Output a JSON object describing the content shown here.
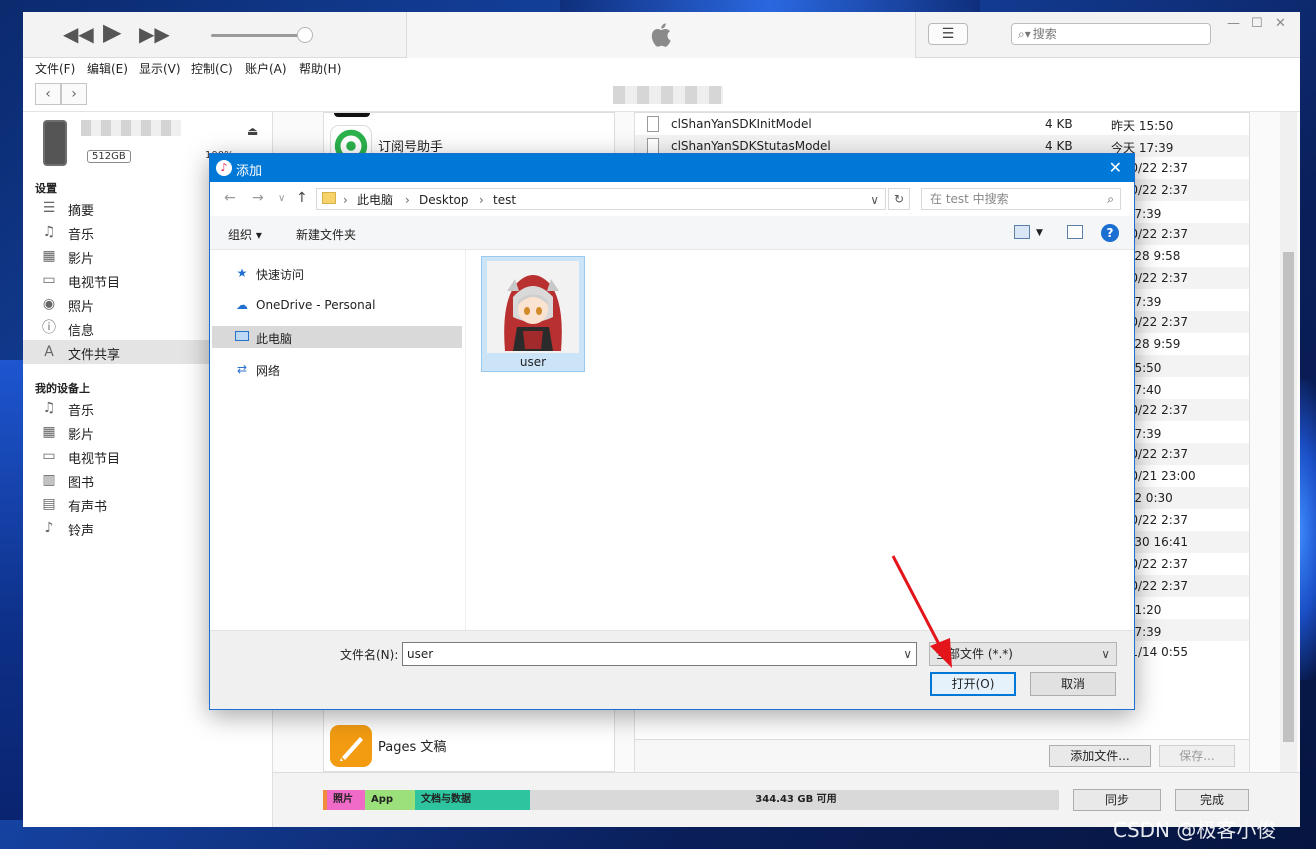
{
  "window": {
    "menu": [
      "文件(F)",
      "编辑(E)",
      "显示(V)",
      "控制(C)",
      "账户(A)",
      "帮助(H)"
    ],
    "search_placeholder": "搜索"
  },
  "sidebar": {
    "capacity": "512GB",
    "battery": "100%",
    "section_settings": "设置",
    "settings_items": [
      {
        "icon": "list-icon",
        "label": "摘要"
      },
      {
        "icon": "music-note-icon",
        "label": "音乐"
      },
      {
        "icon": "film-icon",
        "label": "影片"
      },
      {
        "icon": "tv-icon",
        "label": "电视节目"
      },
      {
        "icon": "camera-icon",
        "label": "照片"
      },
      {
        "icon": "info-icon",
        "label": "信息"
      },
      {
        "icon": "app-store-icon",
        "label": "文件共享"
      }
    ],
    "section_device": "我的设备上",
    "device_items": [
      {
        "icon": "music-note-icon",
        "label": "音乐"
      },
      {
        "icon": "film-icon",
        "label": "影片"
      },
      {
        "icon": "tv-icon",
        "label": "电视节目"
      },
      {
        "icon": "book-icon",
        "label": "图书"
      },
      {
        "icon": "audiobook-icon",
        "label": "有声书"
      },
      {
        "icon": "bell-icon",
        "label": "铃声"
      }
    ]
  },
  "apps": [
    {
      "name": "订阅号助手",
      "color": "#2bb24c"
    },
    {
      "name": "Pages 文稿",
      "color": "#f39c12"
    }
  ],
  "files": [
    {
      "name": "clShanYanSDKInitModel",
      "size": "4 KB",
      "date": "昨天 15:50"
    },
    {
      "name": "clShanYanSDKStutasModel",
      "size": "4 KB",
      "date": "今天 17:39"
    },
    {
      "name": "",
      "size": "",
      "date": "3/10/22 2:37"
    },
    {
      "name": "",
      "size": "",
      "date": "3/10/22 2:37"
    },
    {
      "name": "",
      "size": "",
      "date": "天 17:39"
    },
    {
      "name": "",
      "size": "",
      "date": "3/10/22 2:37"
    },
    {
      "name": "",
      "size": "",
      "date": "3/9/28 9:58"
    },
    {
      "name": "",
      "size": "",
      "date": "3/10/22 2:37"
    },
    {
      "name": "",
      "size": "",
      "date": "天 17:39"
    },
    {
      "name": "",
      "size": "",
      "date": "3/10/22 2:37"
    },
    {
      "name": "",
      "size": "",
      "date": "3/9/28 9:59"
    },
    {
      "name": "",
      "size": "",
      "date": "天 15:50"
    },
    {
      "name": "",
      "size": "",
      "date": "天 17:40"
    },
    {
      "name": "",
      "size": "",
      "date": "3/10/22 2:37"
    },
    {
      "name": "",
      "size": "",
      "date": "天 17:39"
    },
    {
      "name": "",
      "size": "",
      "date": "3/10/22 2:37"
    },
    {
      "name": "",
      "size": "",
      "date": "3/10/21 23:00"
    },
    {
      "name": "",
      "size": "",
      "date": "3/7/2 0:30"
    },
    {
      "name": "",
      "size": "",
      "date": "3/10/22 2:37"
    },
    {
      "name": "",
      "size": "",
      "date": "3/7/30 16:41"
    },
    {
      "name": "",
      "size": "",
      "date": "3/10/22 2:37"
    },
    {
      "name": "",
      "size": "",
      "date": "3/10/22 2:37"
    },
    {
      "name": "",
      "size": "",
      "date": "天 21:20"
    },
    {
      "name": "",
      "size": "",
      "date": "天 17:39"
    },
    {
      "name": "",
      "size": "",
      "date": "2/11/14 0:55"
    }
  ],
  "file_buttons": {
    "add": "添加文件...",
    "save": "保存..."
  },
  "storage": {
    "segments": [
      {
        "label": "照片",
        "color": "#f06ac8"
      },
      {
        "label": "App",
        "color": "#9be07a"
      },
      {
        "label": "文档与数据",
        "color": "#2ec4a0"
      }
    ],
    "free": "344.43 GB 可用",
    "sync": "同步",
    "done": "完成"
  },
  "dialog": {
    "title": "添加",
    "crumbs": [
      "此电脑",
      "Desktop",
      "test"
    ],
    "search_placeholder": "在 test 中搜索",
    "organize": "组织 ▾",
    "new_folder": "新建文件夹",
    "nav": [
      {
        "icon": "star-icon",
        "label": "快速访问"
      },
      {
        "icon": "cloud-icon",
        "label": "OneDrive - Personal"
      },
      {
        "icon": "computer-icon",
        "label": "此电脑"
      },
      {
        "icon": "network-icon",
        "label": "网络"
      }
    ],
    "file_item": "user",
    "filename_label": "文件名(N):",
    "filename_value": "user",
    "filetype": "全部文件 (*.*)",
    "open": "打开(O)",
    "cancel": "取消"
  },
  "watermark": "CSDN @极客小俊"
}
